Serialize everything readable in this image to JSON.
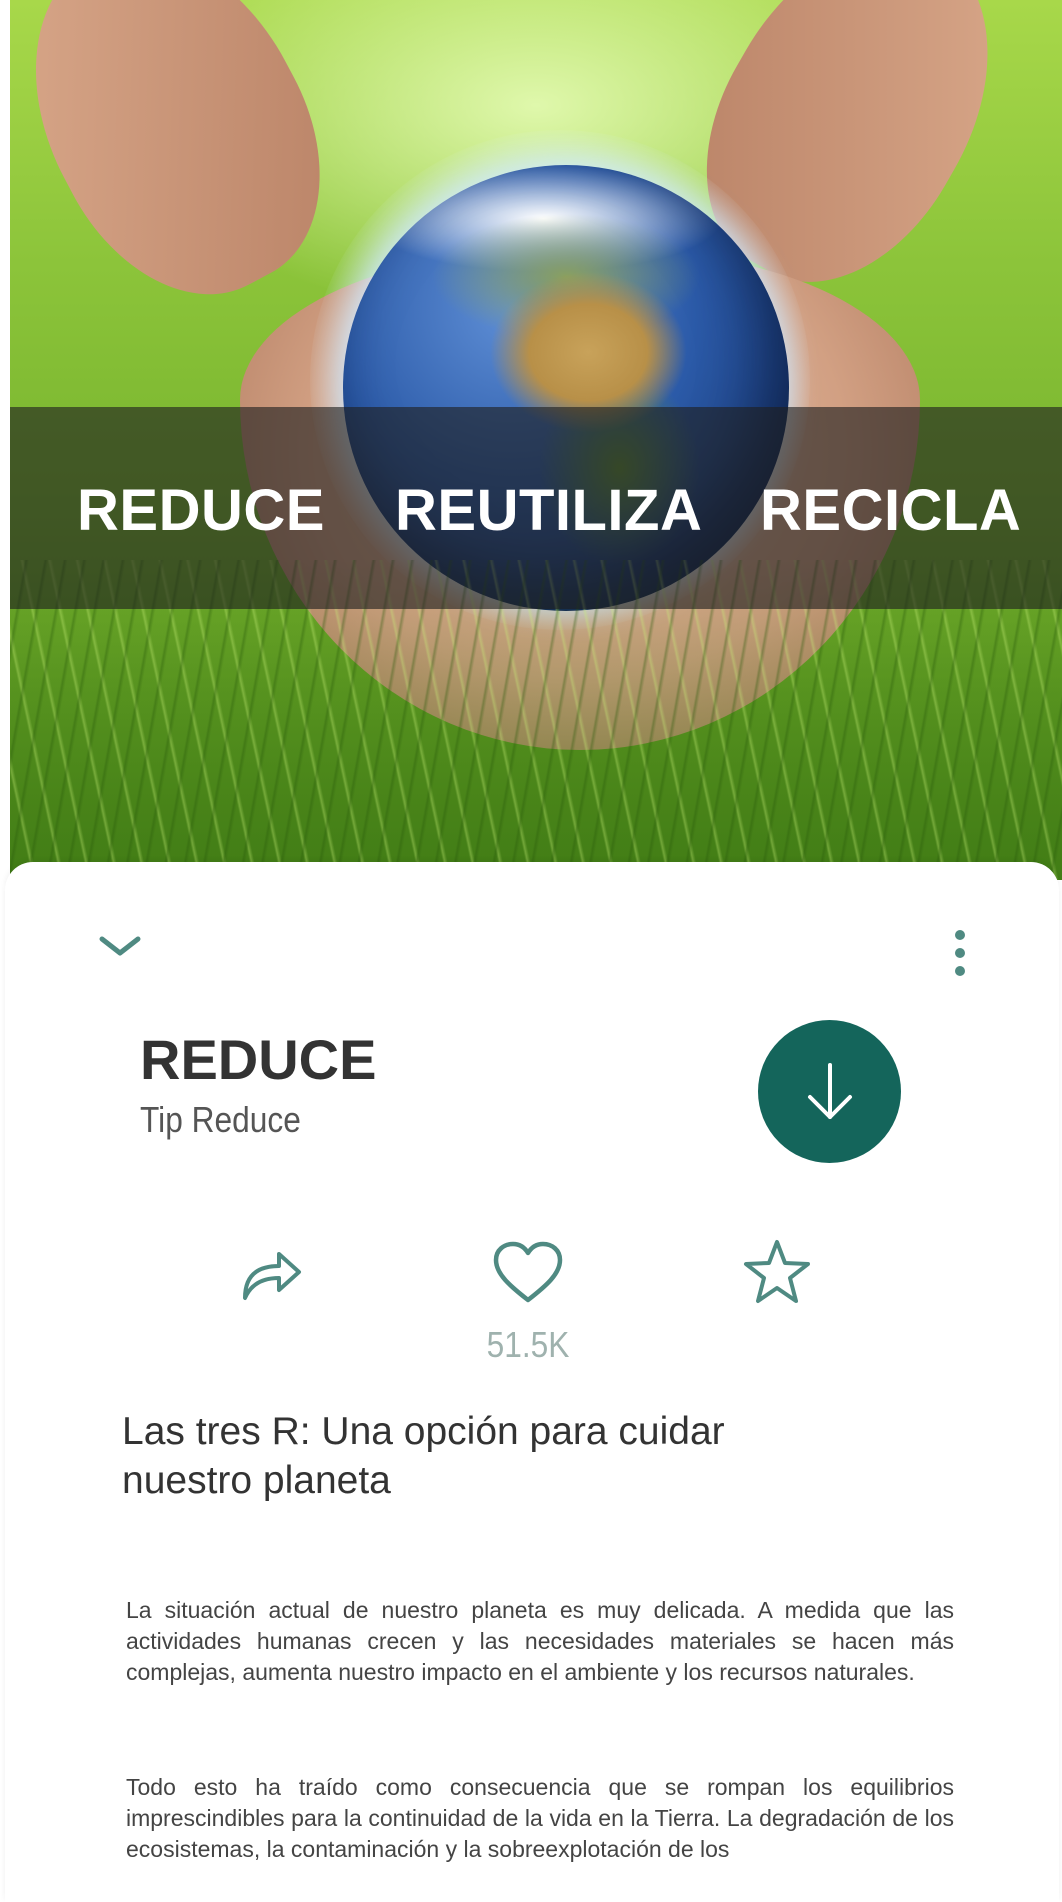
{
  "hero": {
    "words": [
      "REDUCE",
      "REUTILIZA",
      "RECICLA"
    ]
  },
  "sheet": {
    "title": "REDUCE",
    "subtitle": "Tip Reduce",
    "like_count": "51.5K",
    "article_title": "Las tres R: Una opción para cuidar nuestro planeta",
    "paragraphs": [
      "La situación actual de nuestro planeta es muy delicada. A medida que las actividades humanas crecen y las necesidades materiales se hacen más complejas, aumenta nuestro impacto en el ambiente y los recursos naturales.",
      "Todo esto ha traído como consecuencia que se rompan los equilibrios imprescindibles para la continuidad de la vida en la Tierra. La degradación de los ecosistemas, la contaminación y la sobreexplotación de los"
    ]
  },
  "icons": {
    "collapse": "chevron-down-icon",
    "more": "more-vertical-icon",
    "download": "arrow-down-icon",
    "share": "share-icon",
    "like": "heart-icon",
    "favorite": "star-icon"
  },
  "colors": {
    "accent": "#14655b",
    "icon": "#4f8a82",
    "muted": "#9fb2ae"
  }
}
